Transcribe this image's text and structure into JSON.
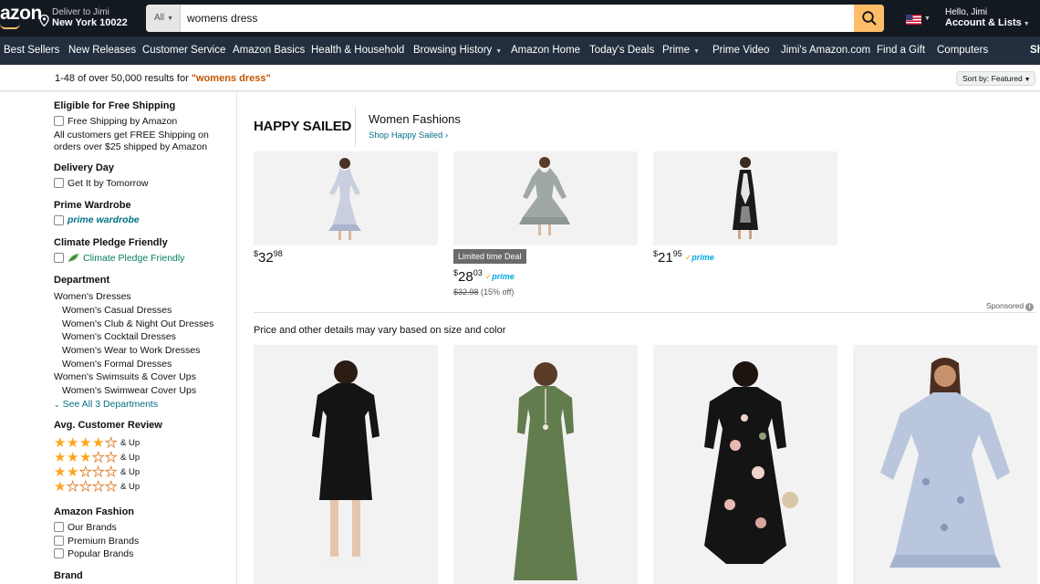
{
  "header": {
    "logo_text": "azon",
    "deliver_line1": "Deliver to Jimi",
    "deliver_line2": "New York 10022",
    "search_category": "All",
    "search_value": "womens dress",
    "account_line1": "Hello, Jimi",
    "account_line2": "Account & Lists"
  },
  "nav": {
    "items": [
      "Best Sellers",
      "New Releases",
      "Customer Service",
      "Amazon Basics",
      "Health & Household",
      "Browsing History",
      "Amazon Home",
      "Today's Deals",
      "Prime",
      "Prime Video",
      "Jimi's Amazon.com",
      "Find a Gift",
      "Computers",
      "Sh"
    ]
  },
  "results": {
    "summary": "1-48 of over 50,000 results for ",
    "query": "\"womens dress\"",
    "sort_label": "Sort by: Featured"
  },
  "sidebar": {
    "free_shipping": {
      "heading": "Eligible for Free Shipping",
      "option": "Free Shipping by Amazon",
      "note": "All customers get FREE Shipping on orders over $25 shipped by Amazon"
    },
    "delivery_day": {
      "heading": "Delivery Day",
      "option": "Get It by Tomorrow"
    },
    "prime_wardrobe": {
      "heading": "Prime Wardrobe",
      "option": "prime wardrobe"
    },
    "climate": {
      "heading": "Climate Pledge Friendly",
      "option": "Climate Pledge Friendly"
    },
    "department": {
      "heading": "Department",
      "items": [
        "Women's Dresses",
        "Women's Casual Dresses",
        "Women's Club & Night Out Dresses",
        "Women's Cocktail Dresses",
        "Women's Wear to Work Dresses",
        "Women's Formal Dresses",
        "Women's Swimsuits & Cover Ups",
        "Women's Swimwear Cover Ups"
      ],
      "see_all": "See All 3 Departments"
    },
    "review": {
      "heading": "Avg. Customer Review",
      "up_label": "& Up",
      "ratings": [
        4,
        3,
        2,
        1
      ]
    },
    "fashion": {
      "heading": "Amazon Fashion",
      "options": [
        "Our Brands",
        "Premium Brands",
        "Popular Brands"
      ]
    },
    "brand": {
      "heading": "Brand"
    }
  },
  "sponsored_brand": {
    "logo": "HAPPY SAILED",
    "title": "Women Fashions",
    "shop_link": "Shop Happy Sailed ›",
    "products": [
      {
        "symbol": "$",
        "whole": "32",
        "fraction": "98",
        "prime": false
      },
      {
        "symbol": "$",
        "whole": "28",
        "fraction": "03",
        "prime": true,
        "deal_badge": "Limited time Deal",
        "was_price": "$32.98",
        "discount": " (15% off)"
      },
      {
        "symbol": "$",
        "whole": "21",
        "fraction": "95",
        "prime": true
      }
    ],
    "prime_label": "prime",
    "sponsored_label": "Sponsored"
  },
  "grid_note": "Price and other details may vary based on size and color",
  "colors": {
    "header_bg": "#131921",
    "nav_bg": "#232f3e",
    "search_button": "#febd69",
    "link": "#007185",
    "query_orange": "#c45500",
    "star": "#ffa41c"
  }
}
